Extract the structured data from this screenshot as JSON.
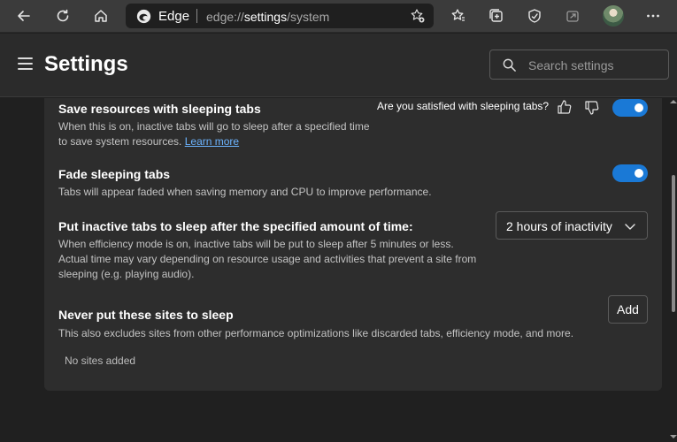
{
  "browser": {
    "address": {
      "site": "Edge",
      "url_prefix": "edge://",
      "url_strong": "settings",
      "url_suffix": "/system"
    }
  },
  "header": {
    "title": "Settings",
    "search_placeholder": "Search settings"
  },
  "sleeping_tabs": {
    "title": "Save resources with sleeping tabs",
    "desc": "When this is on, inactive tabs will go to sleep after a specified time to save system resources.",
    "learn_more": "Learn more",
    "feedback_question": "Are you satisfied with sleeping tabs?",
    "enabled": true
  },
  "fade": {
    "title": "Fade sleeping tabs",
    "desc": "Tabs will appear faded when saving memory and CPU to improve performance.",
    "enabled": true
  },
  "sleep_after": {
    "title": "Put inactive tabs to sleep after the specified amount of time:",
    "desc": "When efficiency mode is on, inactive tabs will be put to sleep after 5 minutes or less. Actual time may vary depending on resource usage and activities that prevent a site from sleeping (e.g. playing audio).",
    "selected": "2 hours of inactivity"
  },
  "never_sleep": {
    "title": "Never put these sites to sleep",
    "desc": "This also excludes sites from other performance optimizations like discarded tabs, efficiency mode, and more.",
    "add_label": "Add",
    "empty_text": "No sites added"
  },
  "colors": {
    "accent": "#1a79d6",
    "link": "#6cb4ff"
  }
}
